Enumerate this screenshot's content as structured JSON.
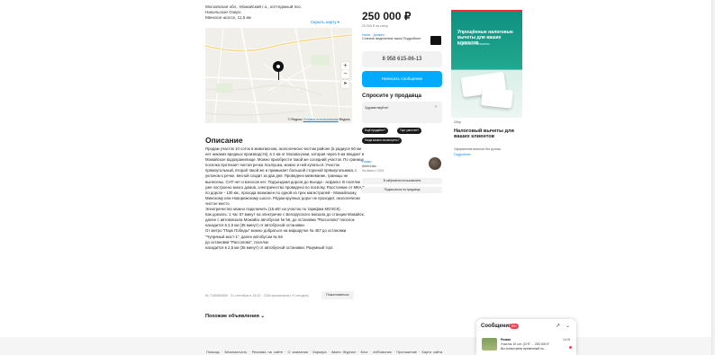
{
  "listing": {
    "address_lines": [
      "Московская обл., Можайский г.о., коттеджный пос.",
      "Никольское Озеро",
      "Минское шоссе, 11,5 км"
    ],
    "hide_map": "Скрыть карту ▾",
    "map_footer_prefix": "© Яндекс",
    "map_footer_link": "Условия использования",
    "map_footer_suffix": "Яндекс",
    "map_zoom_in": "+",
    "map_zoom_out": "−",
    "map_locate": "➤",
    "description_title": "Описание",
    "description": [
      "Продам участок 10 соток в живописном, экологически чистом районе (в радиусе 50 км нет никаких вредных производств), в 2 км от Москва-реки, которая через 5 км впадает в Можайское водохранилище. Можно приобрести такой же соседний участок. По границе поселка протекает чистая речка Хохлушка, можно и ней купаться. Участок прямоугольный, второй такой же и примыкает большой стороной прямоугольника, с уклоном к речке, весной сходит за два дня. Проведено межевание, границы не вынесены. СНТ нет и взносов нет. Подъездная дорога до въезда - асфальт. В посёлке уже построено много домов, электричество проведено по посёлку. Расстояние от МКАД по дороге - 130 км., прохода возможен по одной из трех магистралей - Можайскому, Минскому или Новорижскому шоссе. Рядом крупных дорог не проходит, экологически чистое место.",
      "Электричество можно подключить (15 кВт на участок по тарифам МОЭСК).",
      "Как доехать: 1 час 57 минут на электричке с Белорусского вокзала до станции Можайск,",
      "далее с автовокзала Можайск автобусом № 56, до остановки \"Рассолово\" поселок находится в 2,5 км (35 минут) от автобусной остановки.",
      "От метро \"Парк Победы\" можно добраться на маршрутке № 457 до остановки \"Чупряный мост-1\", далее автобусом № 56",
      "до остановки \"Рассолово\", поселок",
      "находится в 2,5 км (35 минут) от автобусной остановки. Разумный торг."
    ],
    "meta": "№ 7180560806 · 21 сентября в 15:33 · 1336 просмотров (+3 сегодня)",
    "complain": "Пожаловаться",
    "similar": "Похожие объявления ⌄"
  },
  "price_block": {
    "price": "250 000 ₽",
    "price_sub": "25 000 ₽ за сотку",
    "seller_link": "Налог · Должен",
    "seller_promo": "Станьте водителем такси Подробнее",
    "phone": "8 958 615-86-13",
    "message": "Написать сообщение",
    "ask_title": "Спросите у продавца",
    "ask_placeholder": "Здравствуйте!",
    "ask_send": "➤",
    "chips": [
      "Ещё продаёте?",
      "Торг уместен?",
      "Когда можно посмотреть?"
    ],
    "seller_name": "Роман",
    "seller_type": "Агентство",
    "seller_since": "На Авито с 2019",
    "btn_favorite": "В избранном пользователя",
    "btn_subscribe": "Подписаться на продавца"
  },
  "ad": {
    "headline": "Упрощённые налоговые вычеты для ваших клиентов",
    "subline": "Подключите бесплатно",
    "brand": "Сбер",
    "title": "Налоговый вычеты для ваших клиентов",
    "note": "Оформление вычетов без рутины",
    "more": "Подробнее"
  },
  "footer": {
    "links": "Помощь · Безопасность · Реклама на сайте · О компании · Карьера · Авито Журнал · Блог · #яПомогаю · Приложение · Карта сайта"
  },
  "messenger": {
    "title": "Сообщения",
    "badge": "99+",
    "icon_open": "↗",
    "icon_collapse": "⌄",
    "chat_name": "Роман",
    "chat_line1": "Участок 10 сот. (СНТ, ... 250 000 ₽",
    "chat_line2": "Вы посмотрели временный но...",
    "chat_date": "16:05"
  },
  "colors": {
    "accent": "#00aaff",
    "link": "#0a8ae5",
    "badge": "#ff4053"
  }
}
